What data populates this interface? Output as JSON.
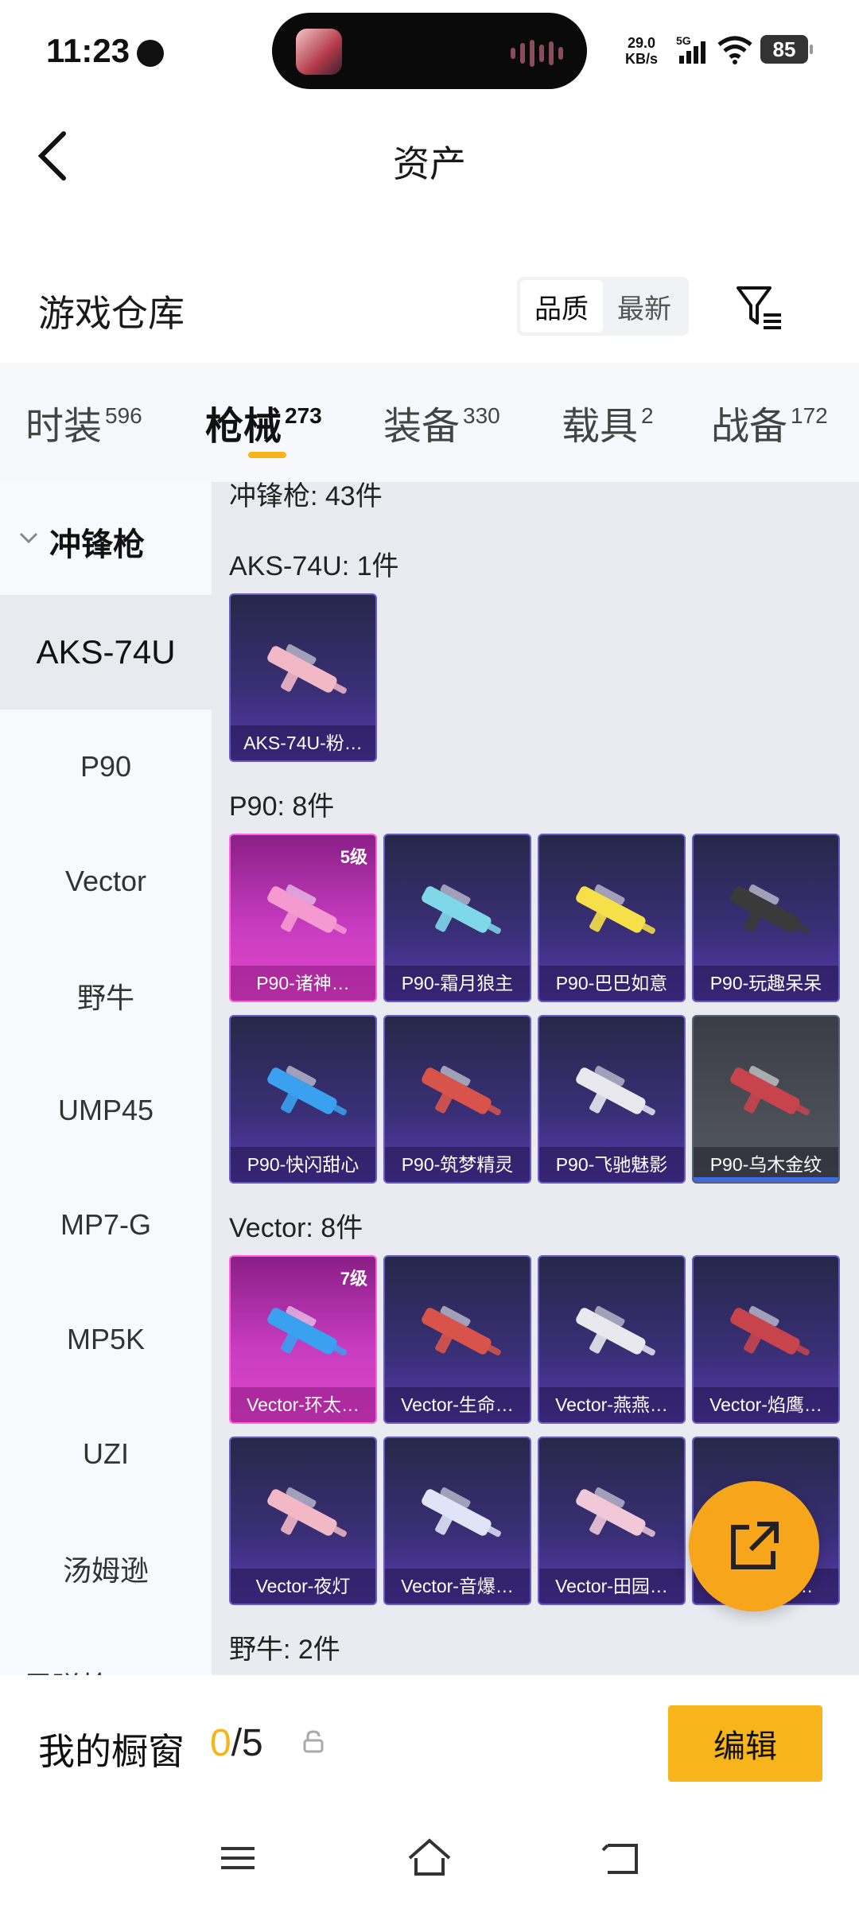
{
  "status": {
    "time": "11:23",
    "net_speed_value": "29.0",
    "net_speed_unit": "KB/s",
    "network": "5G",
    "battery": "85"
  },
  "header": {
    "title": "资产"
  },
  "warehouse": {
    "title": "游戏仓库",
    "sort_options": [
      {
        "label": "品质",
        "active": true
      },
      {
        "label": "最新",
        "active": false
      }
    ]
  },
  "tabs": [
    {
      "label": "时装",
      "count": "596"
    },
    {
      "label": "枪械",
      "count": "273",
      "active": true
    },
    {
      "label": "装备",
      "count": "330"
    },
    {
      "label": "载具",
      "count": "2"
    },
    {
      "label": "战备",
      "count": "172"
    }
  ],
  "sidebar": {
    "group": "冲锋枪",
    "items": [
      "AKS-74U",
      "P90",
      "Vector",
      "野牛",
      "UMP45",
      "MP7-G",
      "MP5K",
      "UZI",
      "汤姆逊"
    ],
    "active": "AKS-74U",
    "next_group_partial": "霰弹枪"
  },
  "content": {
    "group_header": "冲锋枪: 43件",
    "sections": [
      {
        "title": "AKS-74U: 1件",
        "items": [
          {
            "name": "AKS-74U-粉…",
            "style": "purple",
            "level": ""
          }
        ]
      },
      {
        "title": "P90: 8件",
        "items": [
          {
            "name": "P90-诸神…",
            "style": "pink",
            "level": "5级"
          },
          {
            "name": "P90-霜月狼主",
            "style": "purple",
            "level": ""
          },
          {
            "name": "P90-巴巴如意",
            "style": "purple",
            "level": ""
          },
          {
            "name": "P90-玩趣呆呆",
            "style": "purple",
            "level": ""
          },
          {
            "name": "P90-快闪甜心",
            "style": "purple",
            "level": ""
          },
          {
            "name": "P90-筑梦精灵",
            "style": "purple",
            "level": ""
          },
          {
            "name": "P90-飞驰魅影",
            "style": "purple",
            "level": ""
          },
          {
            "name": "P90-乌木金纹",
            "style": "grey",
            "level": ""
          }
        ]
      },
      {
        "title": "Vector: 8件",
        "items": [
          {
            "name": "Vector-环太…",
            "style": "pink",
            "level": "7级"
          },
          {
            "name": "Vector-生命…",
            "style": "purple",
            "level": ""
          },
          {
            "name": "Vector-燕燕…",
            "style": "purple",
            "level": ""
          },
          {
            "name": "Vector-焰鹰…",
            "style": "purple",
            "level": ""
          },
          {
            "name": "Vector-夜灯",
            "style": "purple",
            "level": ""
          },
          {
            "name": "Vector-音爆…",
            "style": "purple",
            "level": ""
          },
          {
            "name": "Vector-田园…",
            "style": "purple",
            "level": ""
          },
          {
            "name": "Vector-红…",
            "style": "purple",
            "level": ""
          }
        ]
      },
      {
        "title": "野牛: 2件",
        "items": []
      }
    ]
  },
  "bottom": {
    "label": "我的橱窗",
    "count_current": "0",
    "count_total": "/5",
    "edit_label": "编辑"
  },
  "colors": {
    "accent": "#f6b31a",
    "card_purple": "#3a2f78",
    "card_pink": "#c73cc0"
  }
}
